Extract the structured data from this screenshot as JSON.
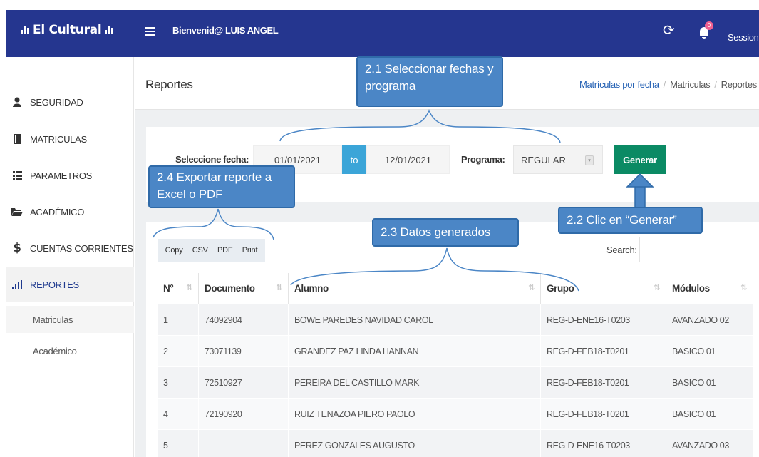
{
  "app": {
    "brand": "El Cultural",
    "welcome": "Bienvenid@ LUIS ANGEL",
    "session": "Session",
    "notification_count": "0"
  },
  "sidebar": {
    "items": [
      {
        "label": "SEGURIDAD",
        "icon": "user-icon"
      },
      {
        "label": "MATRICULAS",
        "icon": "book-icon"
      },
      {
        "label": "PARAMETROS",
        "icon": "list-icon"
      },
      {
        "label": "ACADÉMICO",
        "icon": "folder-open-icon"
      },
      {
        "label": "CUENTAS CORRIENTES",
        "icon": "dollar-icon"
      },
      {
        "label": "REPORTES",
        "icon": "bar-chart-icon"
      }
    ],
    "subitems": [
      "Matriculas",
      "Académico"
    ]
  },
  "page": {
    "title": "Reportes",
    "breadcrumb": [
      "Matrículas por fecha",
      "Matriculas",
      "Reportes"
    ]
  },
  "filter": {
    "date_label": "Seleccione fecha:",
    "date_from": "01/01/2021",
    "to_label": "to",
    "date_to": "12/01/2021",
    "program_label": "Programa:",
    "program_value": "REGULAR",
    "generate_label": "Generar"
  },
  "export": [
    "Copy",
    "CSV",
    "PDF",
    "Print"
  ],
  "search": {
    "label": "Search:",
    "value": ""
  },
  "table": {
    "columns": [
      "N°",
      "Documento",
      "Alumno",
      "Grupo",
      "Módulos"
    ],
    "rows": [
      [
        "1",
        "74092904",
        "BOWE PAREDES NAVIDAD CAROL",
        "REG-D-ENE16-T0203",
        "AVANZADO 02"
      ],
      [
        "2",
        "73071139",
        "GRANDEZ PAZ LINDA HANNAN",
        "REG-D-FEB18-T0201",
        "BASICO 01"
      ],
      [
        "3",
        "72510927",
        "PEREIRA DEL CASTILLO MARK",
        "REG-D-FEB18-T0201",
        "BASICO 01"
      ],
      [
        "4",
        "72190920",
        "RUIZ TENAZOA PIERO PAOLO",
        "REG-D-FEB18-T0201",
        "BASICO 01"
      ],
      [
        "5",
        "-",
        "PEREZ GONZALES AUGUSTO",
        "REG-D-ENE16-T0203",
        "AVANZADO 03"
      ]
    ]
  },
  "callouts": {
    "c1": "2.1 Seleccionar fechas y programa",
    "c2": "2.2 Clic en “Generar”",
    "c3": "2.3 Datos generados",
    "c4": "2.4 Exportar reporte a Excel o PDF"
  },
  "colors": {
    "topbar": "#25368f",
    "generate_button": "#0b8a64",
    "to_addon": "#3ba5d8",
    "callout": "#4b86c6",
    "link": "#2461b4"
  }
}
